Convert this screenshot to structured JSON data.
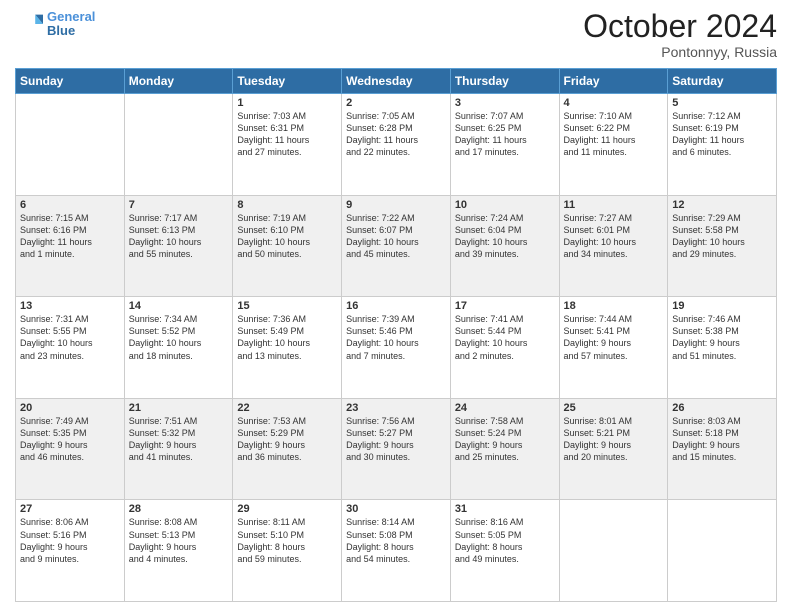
{
  "header": {
    "logo_line1": "General",
    "logo_line2": "Blue",
    "month": "October 2024",
    "location": "Pontonnyy, Russia"
  },
  "weekdays": [
    "Sunday",
    "Monday",
    "Tuesday",
    "Wednesday",
    "Thursday",
    "Friday",
    "Saturday"
  ],
  "weeks": [
    [
      {
        "day": "",
        "info": ""
      },
      {
        "day": "",
        "info": ""
      },
      {
        "day": "1",
        "info": "Sunrise: 7:03 AM\nSunset: 6:31 PM\nDaylight: 11 hours\nand 27 minutes."
      },
      {
        "day": "2",
        "info": "Sunrise: 7:05 AM\nSunset: 6:28 PM\nDaylight: 11 hours\nand 22 minutes."
      },
      {
        "day": "3",
        "info": "Sunrise: 7:07 AM\nSunset: 6:25 PM\nDaylight: 11 hours\nand 17 minutes."
      },
      {
        "day": "4",
        "info": "Sunrise: 7:10 AM\nSunset: 6:22 PM\nDaylight: 11 hours\nand 11 minutes."
      },
      {
        "day": "5",
        "info": "Sunrise: 7:12 AM\nSunset: 6:19 PM\nDaylight: 11 hours\nand 6 minutes."
      }
    ],
    [
      {
        "day": "6",
        "info": "Sunrise: 7:15 AM\nSunset: 6:16 PM\nDaylight: 11 hours\nand 1 minute."
      },
      {
        "day": "7",
        "info": "Sunrise: 7:17 AM\nSunset: 6:13 PM\nDaylight: 10 hours\nand 55 minutes."
      },
      {
        "day": "8",
        "info": "Sunrise: 7:19 AM\nSunset: 6:10 PM\nDaylight: 10 hours\nand 50 minutes."
      },
      {
        "day": "9",
        "info": "Sunrise: 7:22 AM\nSunset: 6:07 PM\nDaylight: 10 hours\nand 45 minutes."
      },
      {
        "day": "10",
        "info": "Sunrise: 7:24 AM\nSunset: 6:04 PM\nDaylight: 10 hours\nand 39 minutes."
      },
      {
        "day": "11",
        "info": "Sunrise: 7:27 AM\nSunset: 6:01 PM\nDaylight: 10 hours\nand 34 minutes."
      },
      {
        "day": "12",
        "info": "Sunrise: 7:29 AM\nSunset: 5:58 PM\nDaylight: 10 hours\nand 29 minutes."
      }
    ],
    [
      {
        "day": "13",
        "info": "Sunrise: 7:31 AM\nSunset: 5:55 PM\nDaylight: 10 hours\nand 23 minutes."
      },
      {
        "day": "14",
        "info": "Sunrise: 7:34 AM\nSunset: 5:52 PM\nDaylight: 10 hours\nand 18 minutes."
      },
      {
        "day": "15",
        "info": "Sunrise: 7:36 AM\nSunset: 5:49 PM\nDaylight: 10 hours\nand 13 minutes."
      },
      {
        "day": "16",
        "info": "Sunrise: 7:39 AM\nSunset: 5:46 PM\nDaylight: 10 hours\nand 7 minutes."
      },
      {
        "day": "17",
        "info": "Sunrise: 7:41 AM\nSunset: 5:44 PM\nDaylight: 10 hours\nand 2 minutes."
      },
      {
        "day": "18",
        "info": "Sunrise: 7:44 AM\nSunset: 5:41 PM\nDaylight: 9 hours\nand 57 minutes."
      },
      {
        "day": "19",
        "info": "Sunrise: 7:46 AM\nSunset: 5:38 PM\nDaylight: 9 hours\nand 51 minutes."
      }
    ],
    [
      {
        "day": "20",
        "info": "Sunrise: 7:49 AM\nSunset: 5:35 PM\nDaylight: 9 hours\nand 46 minutes."
      },
      {
        "day": "21",
        "info": "Sunrise: 7:51 AM\nSunset: 5:32 PM\nDaylight: 9 hours\nand 41 minutes."
      },
      {
        "day": "22",
        "info": "Sunrise: 7:53 AM\nSunset: 5:29 PM\nDaylight: 9 hours\nand 36 minutes."
      },
      {
        "day": "23",
        "info": "Sunrise: 7:56 AM\nSunset: 5:27 PM\nDaylight: 9 hours\nand 30 minutes."
      },
      {
        "day": "24",
        "info": "Sunrise: 7:58 AM\nSunset: 5:24 PM\nDaylight: 9 hours\nand 25 minutes."
      },
      {
        "day": "25",
        "info": "Sunrise: 8:01 AM\nSunset: 5:21 PM\nDaylight: 9 hours\nand 20 minutes."
      },
      {
        "day": "26",
        "info": "Sunrise: 8:03 AM\nSunset: 5:18 PM\nDaylight: 9 hours\nand 15 minutes."
      }
    ],
    [
      {
        "day": "27",
        "info": "Sunrise: 8:06 AM\nSunset: 5:16 PM\nDaylight: 9 hours\nand 9 minutes."
      },
      {
        "day": "28",
        "info": "Sunrise: 8:08 AM\nSunset: 5:13 PM\nDaylight: 9 hours\nand 4 minutes."
      },
      {
        "day": "29",
        "info": "Sunrise: 8:11 AM\nSunset: 5:10 PM\nDaylight: 8 hours\nand 59 minutes."
      },
      {
        "day": "30",
        "info": "Sunrise: 8:14 AM\nSunset: 5:08 PM\nDaylight: 8 hours\nand 54 minutes."
      },
      {
        "day": "31",
        "info": "Sunrise: 8:16 AM\nSunset: 5:05 PM\nDaylight: 8 hours\nand 49 minutes."
      },
      {
        "day": "",
        "info": ""
      },
      {
        "day": "",
        "info": ""
      }
    ]
  ]
}
